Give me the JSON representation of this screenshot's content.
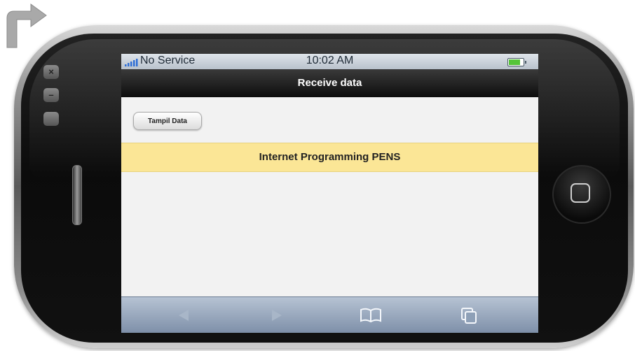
{
  "status_bar": {
    "carrier": "No Service",
    "time": "10:02 AM",
    "battery_level": 0.9
  },
  "nav": {
    "title": "Receive data"
  },
  "content": {
    "button_label": "Tampil Data",
    "banner_text": "Internet Programming PENS"
  },
  "toolbar": {
    "icons": [
      "back-icon",
      "forward-icon",
      "bookmarks-icon",
      "pages-icon"
    ]
  },
  "device": {
    "side_controls": [
      "close-icon",
      "minimize-icon",
      "rotate-icon"
    ]
  },
  "colors": {
    "banner": "#fbe696",
    "title_bar": "#1a1a1a",
    "toolbar": "#9aabbf"
  }
}
